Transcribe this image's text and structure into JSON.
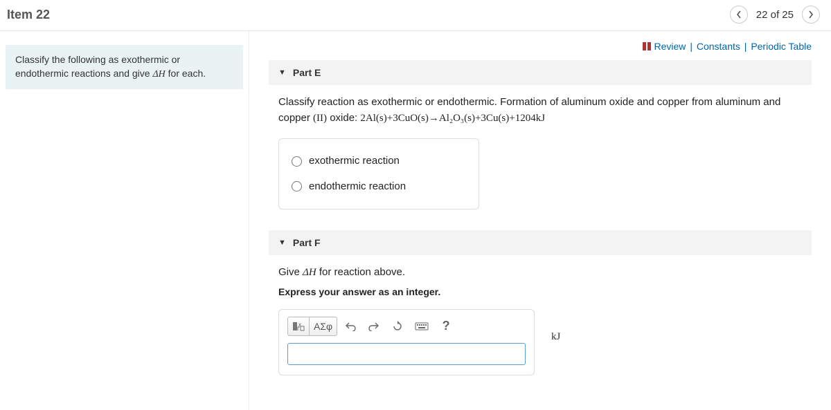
{
  "header": {
    "title": "Item 22",
    "position": "22 of 25"
  },
  "links": {
    "review": "Review",
    "constants": "Constants",
    "periodic": "Periodic Table"
  },
  "prompt": {
    "text_before": "Classify the following as exothermic or endothermic reactions and give ",
    "delta_h": "ΔH",
    "text_after": " for each."
  },
  "partE": {
    "label": "Part E",
    "q_lead": "Classify reaction as exothermic or endothermic. Formation of aluminum oxide and copper from aluminum and copper ",
    "roman": "(II)",
    "q_mid": " oxide: ",
    "equation": "2Al(s)+3CuO(s)→Al₂O₃(s)+3Cu(s)+1204kJ",
    "opt1": "exothermic reaction",
    "opt2": "endothermic reaction"
  },
  "partF": {
    "label": "Part F",
    "q_before": "Give ",
    "delta_h": "ΔH",
    "q_after": " for reaction above.",
    "instruct": "Express your answer as an integer.",
    "unit": "kJ",
    "greek_btn": "ΑΣφ"
  }
}
